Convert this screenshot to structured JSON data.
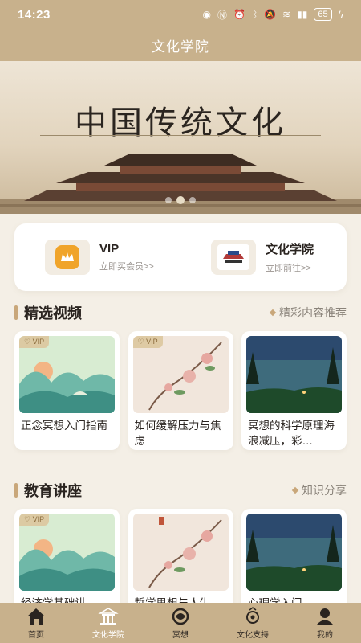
{
  "status": {
    "time": "14:23",
    "battery": "65"
  },
  "header": {
    "title": "文化学院"
  },
  "hero": {
    "title": "中国传统文化",
    "slides": 3,
    "active_slide": 1
  },
  "quick": [
    {
      "title": "VIP",
      "subtitle": "立即买会员>>",
      "icon": "crown-icon"
    },
    {
      "title": "文化学院",
      "subtitle": "立即前往>>",
      "icon": "culture-logo-icon"
    }
  ],
  "featured": {
    "title": "精选视频",
    "more": "精彩内容推荐",
    "items": [
      {
        "title": "正念冥想入门指南",
        "vip": "VIP",
        "thumb": "mountain"
      },
      {
        "title": "如何缓解压力与焦虑",
        "vip": "VIP",
        "thumb": "blossom"
      },
      {
        "title": "冥想的科学原理海浪减压，彩…",
        "vip": "",
        "thumb": "night"
      }
    ]
  },
  "lectures": {
    "title": "教育讲座",
    "more": "知识分享",
    "items": [
      {
        "title": "经济学基础讲",
        "vip": "VIP",
        "thumb": "mountain"
      },
      {
        "title": "哲学思想与人生",
        "vip": "",
        "thumb": "blossom"
      },
      {
        "title": "心理学入门",
        "vip": "",
        "thumb": "night"
      }
    ]
  },
  "nav": [
    {
      "label": "首页",
      "icon": "home-icon"
    },
    {
      "label": "文化学院",
      "icon": "temple-icon",
      "active": true
    },
    {
      "label": "冥想",
      "icon": "meditation-icon"
    },
    {
      "label": "文化支持",
      "icon": "support-icon"
    },
    {
      "label": "我的",
      "icon": "profile-icon"
    }
  ],
  "colors": {
    "bar": "#c8b18c",
    "accent": "#c9a77a",
    "background": "#f4efe6"
  }
}
